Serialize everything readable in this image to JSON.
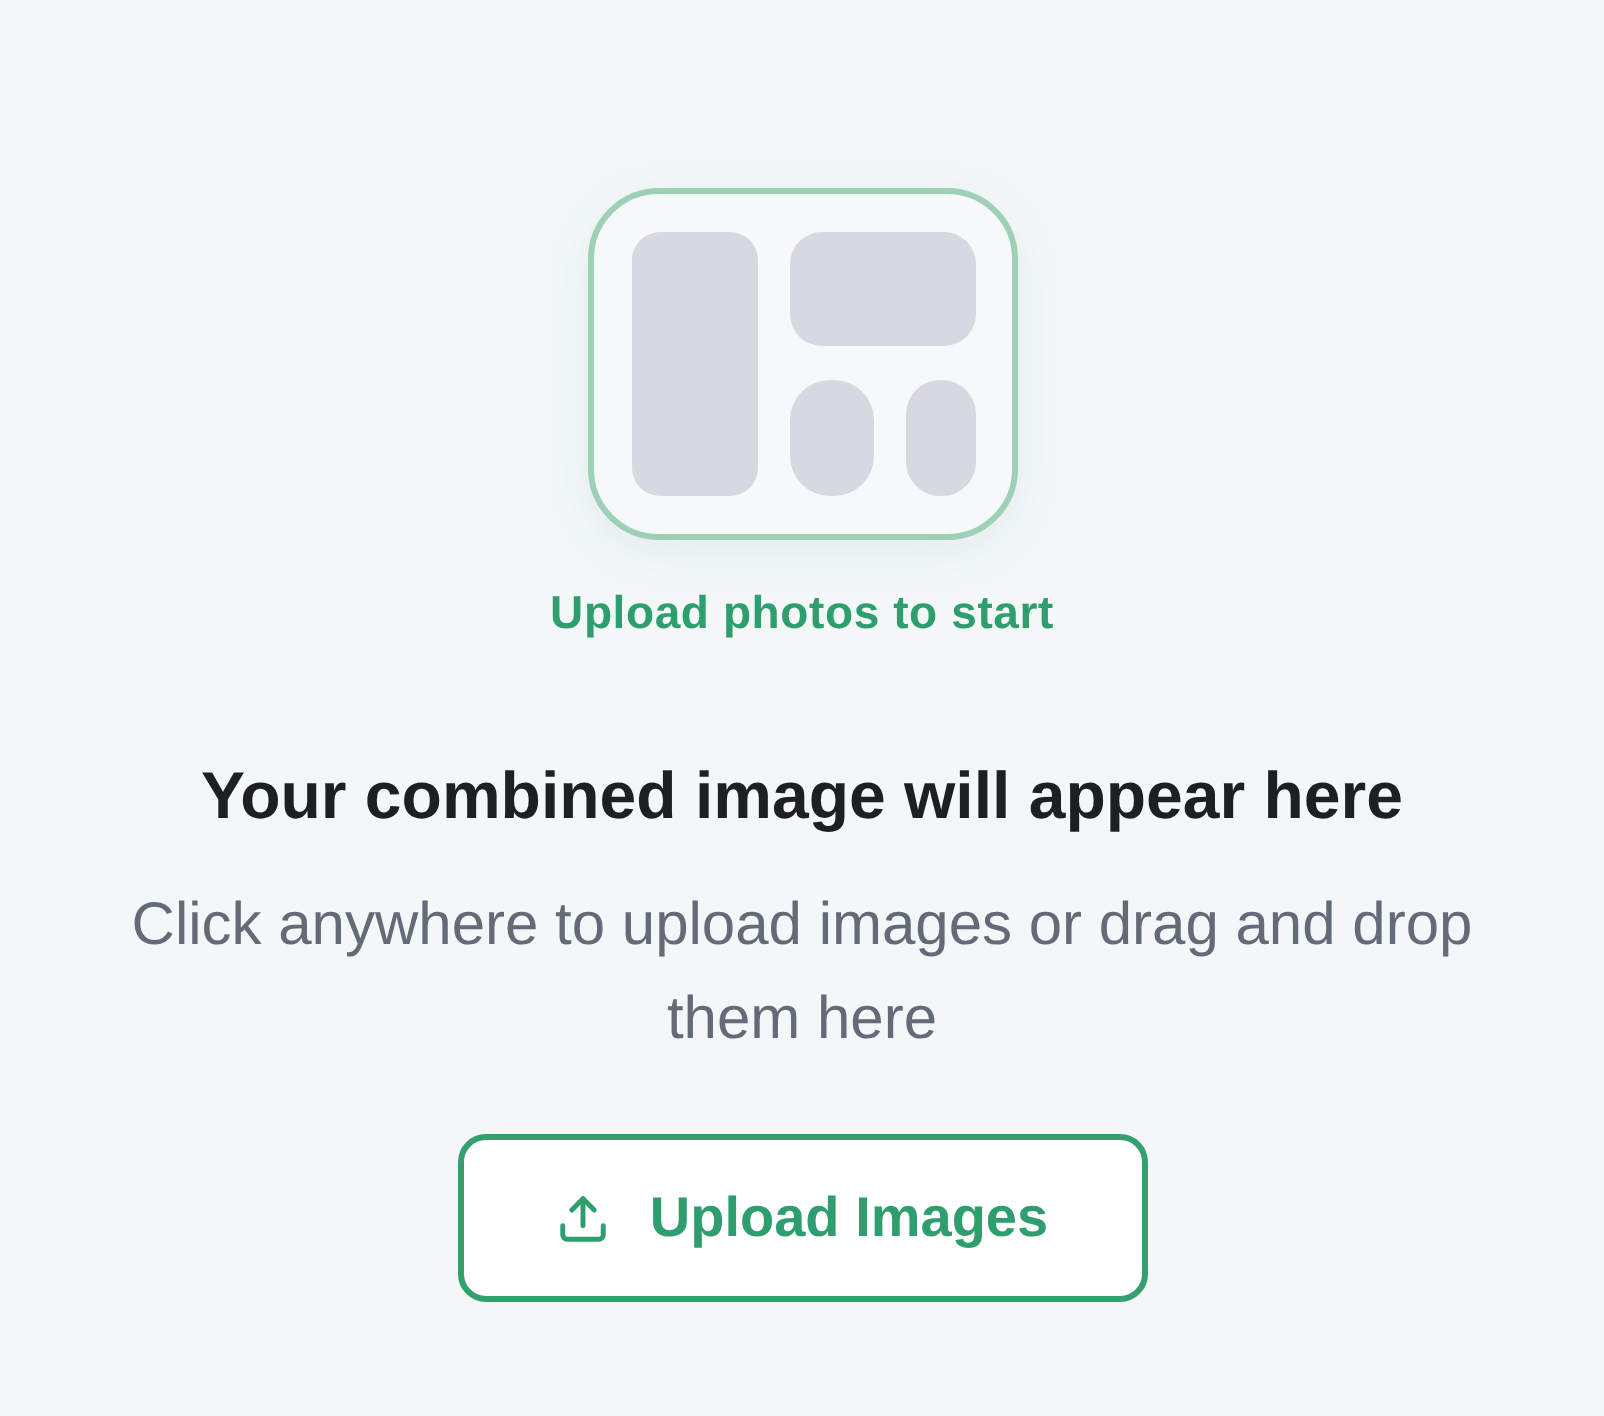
{
  "placeholder": {
    "caption": "Upload photos to start"
  },
  "heading": "Your combined image will appear here",
  "description": "Click anywhere to upload images or drag and drop them here",
  "upload_button": {
    "label": "Upload Images"
  }
}
